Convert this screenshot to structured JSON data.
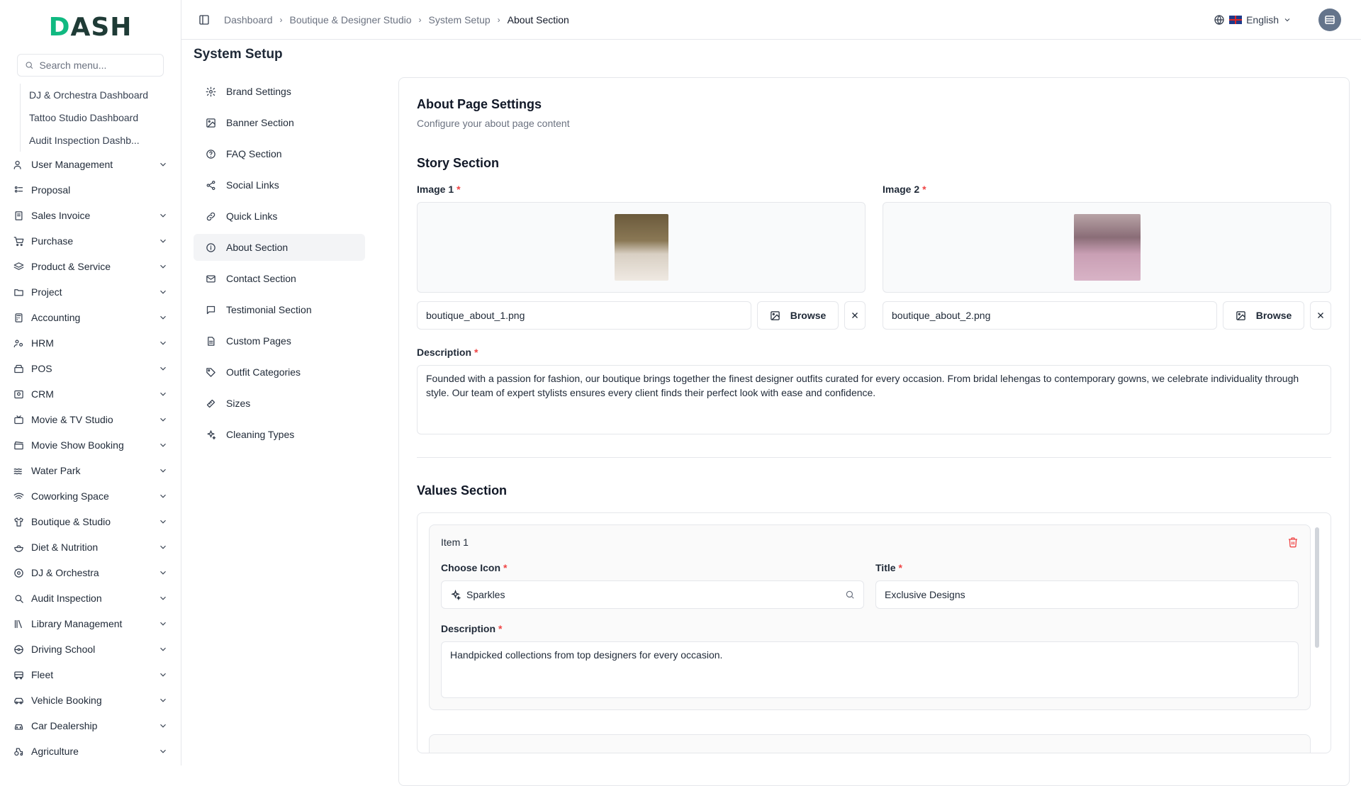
{
  "app": {
    "logo": "DASH"
  },
  "sidebar": {
    "search_placeholder": "Search menu...",
    "sub_items": [
      "DJ & Orchestra Dashboard",
      "Tattoo Studio Dashboard",
      "Audit Inspection Dashb..."
    ],
    "items": [
      {
        "label": "User Management",
        "icon": "users-icon",
        "expandable": true
      },
      {
        "label": "Proposal",
        "icon": "proposal-icon",
        "expandable": false
      },
      {
        "label": "Sales Invoice",
        "icon": "invoice-icon",
        "expandable": true
      },
      {
        "label": "Purchase",
        "icon": "cart-icon",
        "expandable": true
      },
      {
        "label": "Product & Service",
        "icon": "layers-icon",
        "expandable": true
      },
      {
        "label": "Project",
        "icon": "folder-icon",
        "expandable": true
      },
      {
        "label": "Accounting",
        "icon": "calculator-icon",
        "expandable": true
      },
      {
        "label": "HRM",
        "icon": "hrm-icon",
        "expandable": true
      },
      {
        "label": "POS",
        "icon": "pos-icon",
        "expandable": true
      },
      {
        "label": "CRM",
        "icon": "crm-icon",
        "expandable": true
      },
      {
        "label": "Movie & TV Studio",
        "icon": "tv-icon",
        "expandable": true
      },
      {
        "label": "Movie Show Booking",
        "icon": "clapper-icon",
        "expandable": true
      },
      {
        "label": "Water Park",
        "icon": "waves-icon",
        "expandable": true
      },
      {
        "label": "Coworking Space",
        "icon": "wifi-icon",
        "expandable": true
      },
      {
        "label": "Boutique & Studio",
        "icon": "shirt-icon",
        "expandable": true
      },
      {
        "label": "Diet & Nutrition",
        "icon": "salad-icon",
        "expandable": true
      },
      {
        "label": "DJ & Orchestra",
        "icon": "disc-icon",
        "expandable": true
      },
      {
        "label": "Audit Inspection",
        "icon": "search-doc-icon",
        "expandable": true
      },
      {
        "label": "Library Management",
        "icon": "library-icon",
        "expandable": true
      },
      {
        "label": "Driving School",
        "icon": "steering-icon",
        "expandable": true
      },
      {
        "label": "Fleet",
        "icon": "bus-icon",
        "expandable": true
      },
      {
        "label": "Vehicle Booking",
        "icon": "car-icon",
        "expandable": true
      },
      {
        "label": "Car Dealership",
        "icon": "car-front-icon",
        "expandable": true
      },
      {
        "label": "Agriculture",
        "icon": "tractor-icon",
        "expandable": true
      }
    ]
  },
  "header": {
    "breadcrumbs": [
      "Dashboard",
      "Boutique & Designer Studio",
      "System Setup",
      "About Section"
    ],
    "language": "English"
  },
  "page": {
    "title": "System Setup"
  },
  "settings_nav": [
    {
      "label": "Brand Settings",
      "icon": "gear-icon",
      "active": false
    },
    {
      "label": "Banner Section",
      "icon": "image-icon",
      "active": false
    },
    {
      "label": "FAQ Section",
      "icon": "help-circle-icon",
      "active": false
    },
    {
      "label": "Social Links",
      "icon": "share-icon",
      "active": false
    },
    {
      "label": "Quick Links",
      "icon": "link-icon",
      "active": false
    },
    {
      "label": "About Section",
      "icon": "info-icon",
      "active": true
    },
    {
      "label": "Contact Section",
      "icon": "mail-icon",
      "active": false
    },
    {
      "label": "Testimonial Section",
      "icon": "message-icon",
      "active": false
    },
    {
      "label": "Custom Pages",
      "icon": "file-icon",
      "active": false
    },
    {
      "label": "Outfit Categories",
      "icon": "tag-icon",
      "active": false
    },
    {
      "label": "Sizes",
      "icon": "ruler-icon",
      "active": false
    },
    {
      "label": "Cleaning Types",
      "icon": "sparkles-icon",
      "active": false
    }
  ],
  "about": {
    "title": "About Page Settings",
    "subtitle": "Configure your about page content",
    "story": {
      "title": "Story Section",
      "image1_label": "Image 1",
      "image1_file": "boutique_about_1.png",
      "image2_label": "Image 2",
      "image2_file": "boutique_about_2.png",
      "browse_label": "Browse",
      "description_label": "Description",
      "description": "Founded with a passion for fashion, our boutique brings together the finest designer outfits curated for every occasion. From bridal lehengas to contemporary gowns, we celebrate individuality through style. Our team of expert stylists ensures every client finds their perfect look with ease and confidence."
    },
    "values": {
      "title": "Values Section",
      "items": [
        {
          "heading": "Item 1",
          "icon_label": "Choose Icon",
          "icon_value": "Sparkles",
          "title_label": "Title",
          "title_value": "Exclusive Designs",
          "description_label": "Description",
          "description_value": "Handpicked collections from top designers for every occasion."
        }
      ]
    }
  },
  "colors": {
    "accent": "#10b981",
    "required": "#ef4444",
    "danger": "#ef4444",
    "border": "#e5e7eb"
  }
}
